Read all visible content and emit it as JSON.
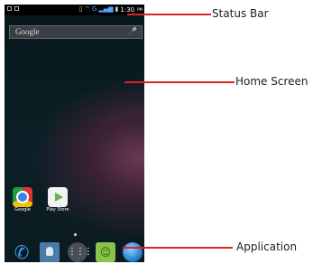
{
  "status_bar": {
    "time": "1:30",
    "ampm": "PM",
    "icons": [
      "notification-icon",
      "sd-icon",
      "vibrate-icon",
      "wifi-icon",
      "g-network-icon",
      "signal-icon",
      "battery-icon"
    ]
  },
  "search": {
    "label": "Google",
    "icon": "mic-icon"
  },
  "apps": [
    {
      "label": "Google",
      "icon": "chrome-icon"
    },
    {
      "label": "Play Store",
      "icon": "play-store-icon"
    }
  ],
  "dock": [
    "phone-icon",
    "contacts-icon",
    "app-launcher-icon",
    "messaging-icon",
    "browser-icon"
  ],
  "callouts": {
    "status_bar": "Status Bar",
    "home_screen": "Home Screen",
    "application": "Application"
  },
  "colors": {
    "callout_line": "#dd2222",
    "accent": "#3ba3ff"
  }
}
